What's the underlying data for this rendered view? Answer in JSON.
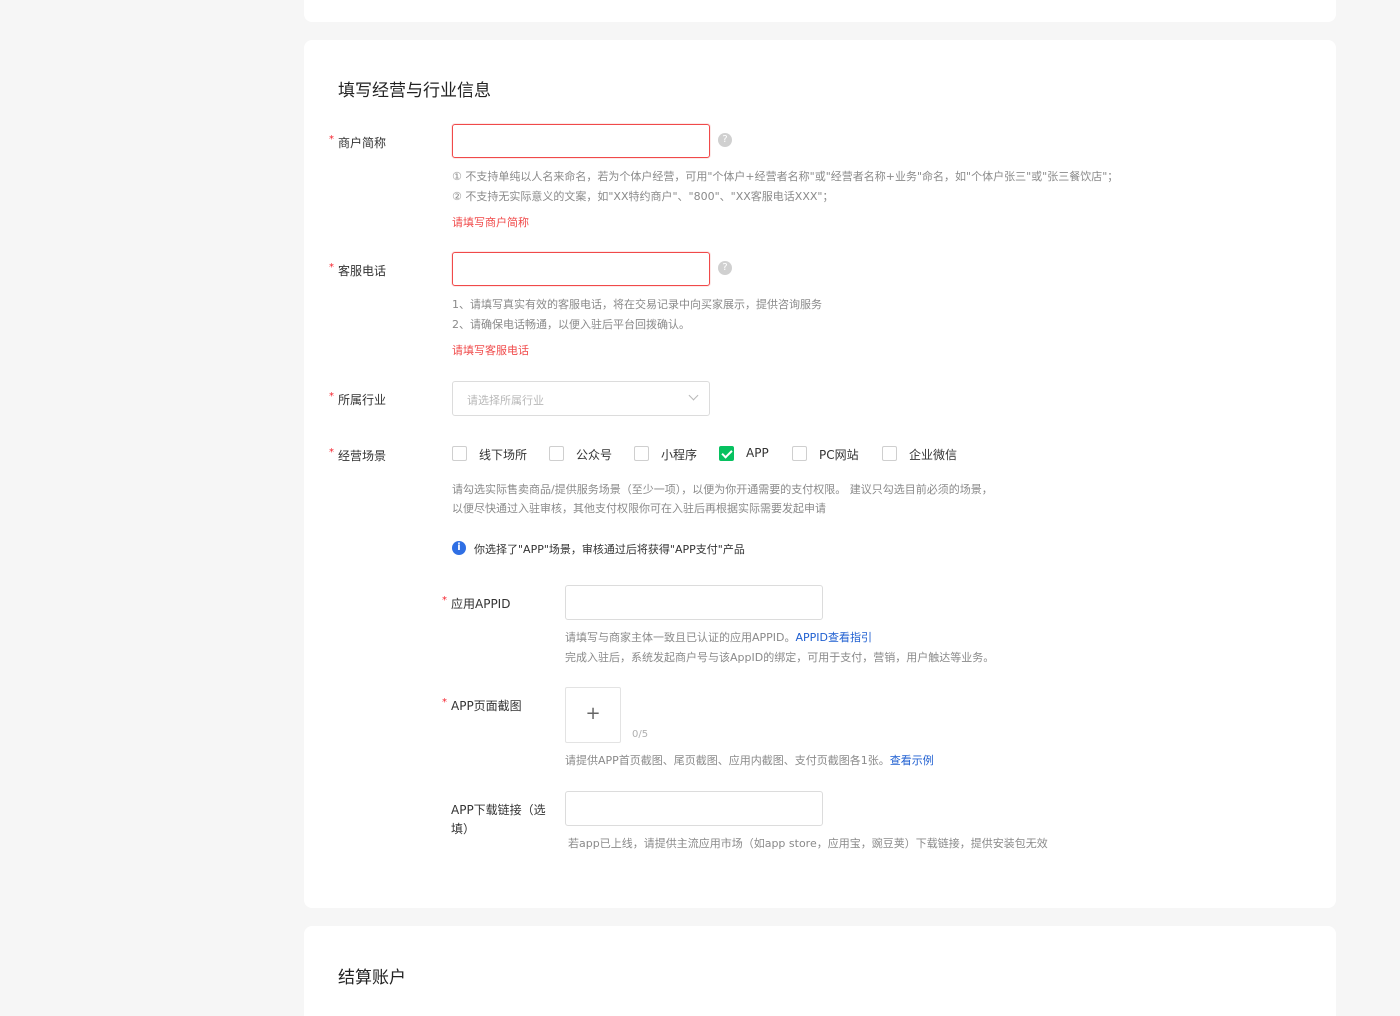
{
  "section_business": {
    "title": "填写经营与行业信息",
    "required_mark": "*",
    "merchant_name": {
      "label": "商户简称",
      "value": "",
      "help_icon": "question-icon",
      "hints": [
        "① 不支持单纯以人名来命名，若为个体户经营，可用\"个体户+经营者名称\"或\"经营者名称+业务\"命名，如\"个体户张三\"或\"张三餐饮店\"；",
        "② 不支持无实际意义的文案，如\"XX特约商户\"、\"800\"、\"XX客服电话XXX\"；"
      ],
      "error": "请填写商户简称"
    },
    "service_phone": {
      "label": "客服电话",
      "value": "",
      "help_icon": "question-icon",
      "hints": [
        "1、请填写真实有效的客服电话，将在交易记录中向买家展示，提供咨询服务",
        "2、请确保电话畅通，以便入驻后平台回拨确认。"
      ],
      "error": "请填写客服电话"
    },
    "industry": {
      "label": "所属行业",
      "placeholder": "请选择所属行业"
    },
    "scenes": {
      "label": "经营场景",
      "options": [
        {
          "label": "线下场所",
          "checked": false
        },
        {
          "label": "公众号",
          "checked": false
        },
        {
          "label": "小程序",
          "checked": false
        },
        {
          "label": "APP",
          "checked": true
        },
        {
          "label": "PC网站",
          "checked": false
        },
        {
          "label": "企业微信",
          "checked": false
        }
      ],
      "hints": [
        "请勾选实际售卖商品/提供服务场景（至少一项），以便为你开通需要的支付权限。 建议只勾选目前必须的场景，",
        "以便尽快通过入驻审核，其他支付权限你可在入驻后再根据实际需要发起申请"
      ],
      "notice": "你选择了\"APP\"场景，审核通过后将获得\"APP支付\"产品"
    },
    "app_id": {
      "label": "应用APPID",
      "value": "",
      "hint_line1": "请填写与商家主体一致且已认证的应用APPID。",
      "hint_link": "APPID查看指引",
      "hint_line2": "完成入驻后，系统发起商户号与该AppID的绑定，可用于支付，营销，用户触达等业务。"
    },
    "app_screenshot": {
      "label": "APP页面截图",
      "upload_symbol": "+",
      "counter": "0/5",
      "hint": "请提供APP首页截图、尾页截图、应用内截图、支付页截图各1张。",
      "hint_link": "查看示例"
    },
    "app_download": {
      "label_line1": "APP下载链接（选",
      "label_line2": "填）",
      "value": "",
      "hint": "若app已上线，请提供主流应用市场（如app store，应用宝，豌豆荚）下载链接，提供安装包无效"
    }
  },
  "section_settlement": {
    "title": "结算账户"
  }
}
